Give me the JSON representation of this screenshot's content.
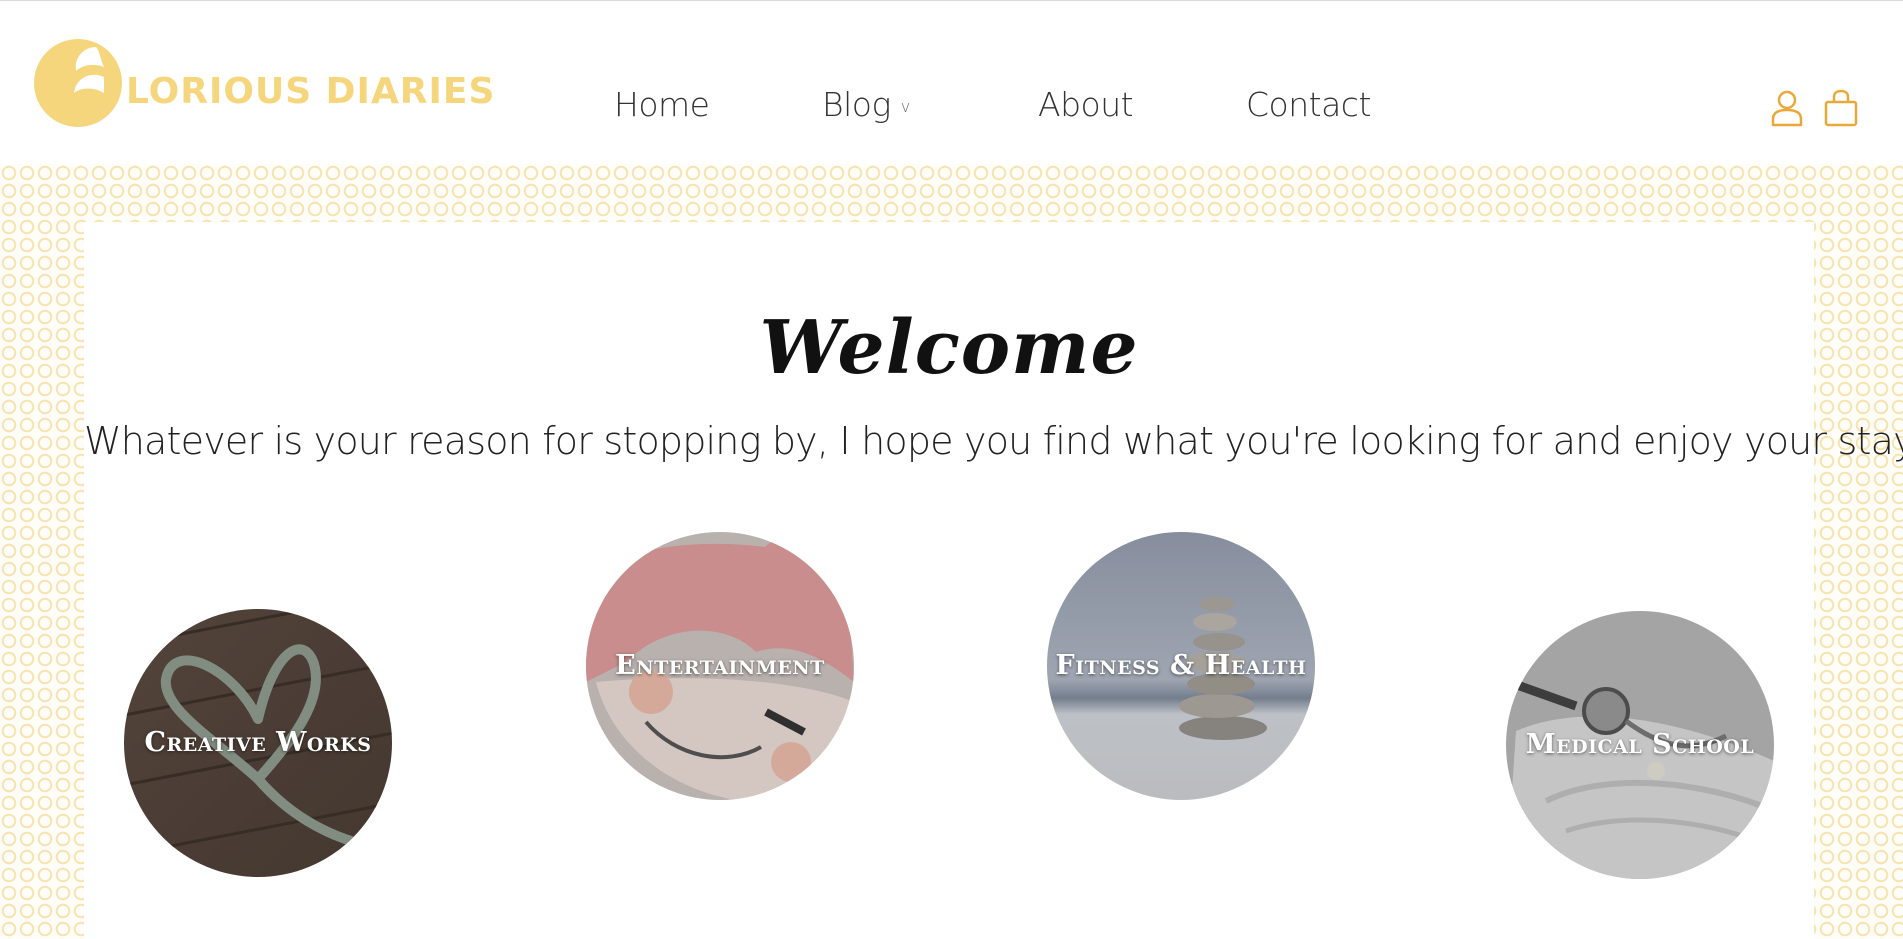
{
  "brand": {
    "logo_text": "LORIOUS DIARIES",
    "logo_color": "#f5d67c"
  },
  "nav": {
    "items": [
      {
        "label": "Home"
      },
      {
        "label": "Blog",
        "has_dropdown": true,
        "chevron": "v"
      },
      {
        "label": "About"
      },
      {
        "label": "Contact"
      }
    ]
  },
  "header_icons": {
    "user": "user-icon",
    "cart": "shopping-bag-icon",
    "color": "#e8a93a"
  },
  "hero": {
    "title": "Welcome",
    "tagline": "Whatever is your reason for stopping by, I hope you find what you're looking for and enjoy your stay",
    "heart": "♡",
    "heart_color": "#8a5ba8"
  },
  "categories": [
    {
      "label": "Creative Works",
      "image": "knit-heart-on-wood"
    },
    {
      "label": "Entertainment",
      "image": "anime-character"
    },
    {
      "label": "Fitness & Health",
      "image": "stacked-stones"
    },
    {
      "label": "Medical School",
      "image": "stethoscope-on-book"
    }
  ],
  "theme": {
    "pattern_color": "#f7e3b0",
    "text_color": "#222222"
  }
}
